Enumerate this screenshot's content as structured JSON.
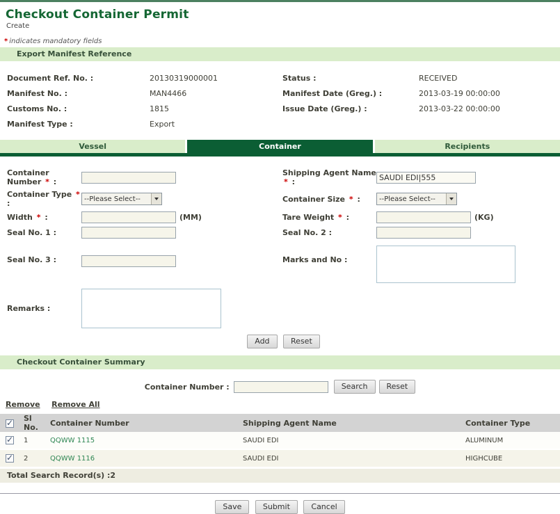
{
  "page": {
    "title": "Checkout Container Permit",
    "subtitle": "Create",
    "star": "*",
    "colon": ":",
    "mandatory_note": "indicates mandatory fields"
  },
  "colors": {
    "accent_dark_green": "#0b5e34",
    "section_bar_bg": "#d9edca",
    "link_green": "#2e8653",
    "required_red": "#cc0000",
    "topbar_green": "#4c8060"
  },
  "manifest": {
    "section_title": "Export Manifest Reference",
    "left": [
      {
        "label": "Document Ref. No. :",
        "value": "20130319000001"
      },
      {
        "label": "Manifest No. :",
        "value": "MAN4466"
      },
      {
        "label": "Customs No. :",
        "value": "1815"
      },
      {
        "label": "Manifest Type :",
        "value": "Export"
      }
    ],
    "right": [
      {
        "label": "Status :",
        "value": "RECEIVED"
      },
      {
        "label": "Manifest Date (Greg.) :",
        "value": "2013-03-19 00:00:00"
      },
      {
        "label": "Issue Date (Greg.) :",
        "value": "2013-03-22 00:00:00"
      }
    ]
  },
  "tabs": [
    {
      "label": "Vessel"
    },
    {
      "label": "Container"
    },
    {
      "label": "Recipients"
    }
  ],
  "form": {
    "container_number_label": "Container Number",
    "shipping_agent_label": "Shipping Agent Name",
    "shipping_agent_value": "SAUDI EDI|555",
    "container_type_label": "Container Type",
    "container_size_label": "Container Size",
    "please_select": "--Please Select--",
    "width_label": "Width",
    "width_unit": "(MM)",
    "tare_weight_label": "Tare Weight",
    "tare_weight_unit": "(KG)",
    "seal1_label": "Seal No. 1 :",
    "seal2_label": "Seal No. 2 :",
    "seal3_label": "Seal No. 3 :",
    "marks_label": "Marks and No :",
    "remarks_label": "Remarks :",
    "add_button": "Add",
    "reset_button": "Reset"
  },
  "summary": {
    "section_title": "Checkout Container Summary",
    "search_label": "Container Number :",
    "search_button": "Search",
    "reset_button": "Reset",
    "remove_link": "Remove",
    "remove_all_link": "Remove All",
    "table": {
      "headers": {
        "sl": "Sl No.",
        "container_number": "Container Number",
        "agent": "Shipping Agent Name",
        "type": "Container Type"
      },
      "rows": [
        {
          "sl": "1",
          "container_number": "QQWW 1115",
          "agent": "SAUDI EDI",
          "type": "ALUMINUM",
          "checked": true
        },
        {
          "sl": "2",
          "container_number": "QQWW 1116",
          "agent": "SAUDI EDI",
          "type": "HIGHCUBE",
          "checked": true
        }
      ]
    },
    "total_text": "Total Search Record(s) :2"
  },
  "footer": {
    "save": "Save",
    "submit": "Submit",
    "cancel": "Cancel"
  }
}
